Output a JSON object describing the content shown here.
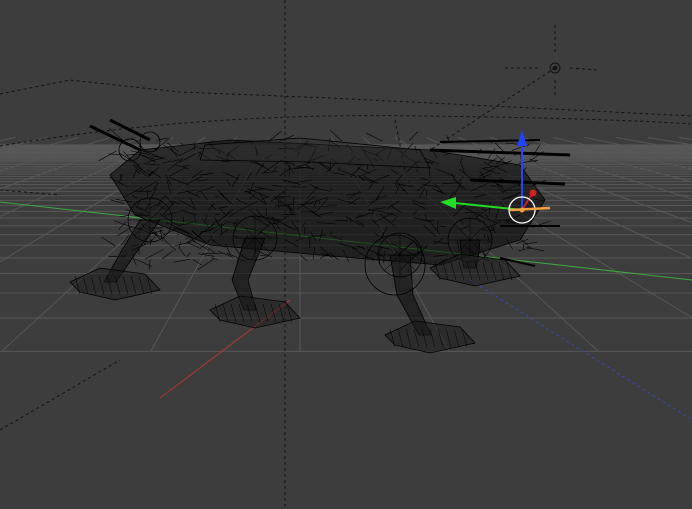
{
  "app": {
    "name": "3D viewport",
    "view": "perspective"
  },
  "viewport": {
    "shading_mode": "wireframe",
    "background_color": "#3d3d3d",
    "grid_color": "#575757",
    "wire_color": "#000000",
    "axis_x_color": "#b03838",
    "axis_y_color": "#3fa83f",
    "grid_visible": true
  },
  "scene": {
    "objects": [
      {
        "name": "walker-mecha-wireframe",
        "type": "mesh",
        "selected": false
      },
      {
        "name": "lamp",
        "type": "light",
        "icon": "sun-lamp-icon"
      },
      {
        "name": "camera",
        "type": "camera",
        "icon": "camera-icon"
      }
    ],
    "transform_manipulator": {
      "visible": true,
      "axes": [
        {
          "axis": "x",
          "color": "#cc2222"
        },
        {
          "axis": "y",
          "color": "#22dd22"
        },
        {
          "axis": "z",
          "color": "#2244ff"
        }
      ]
    },
    "3d_cursor": {
      "visible": true,
      "icon": "3d-cursor-icon"
    }
  }
}
